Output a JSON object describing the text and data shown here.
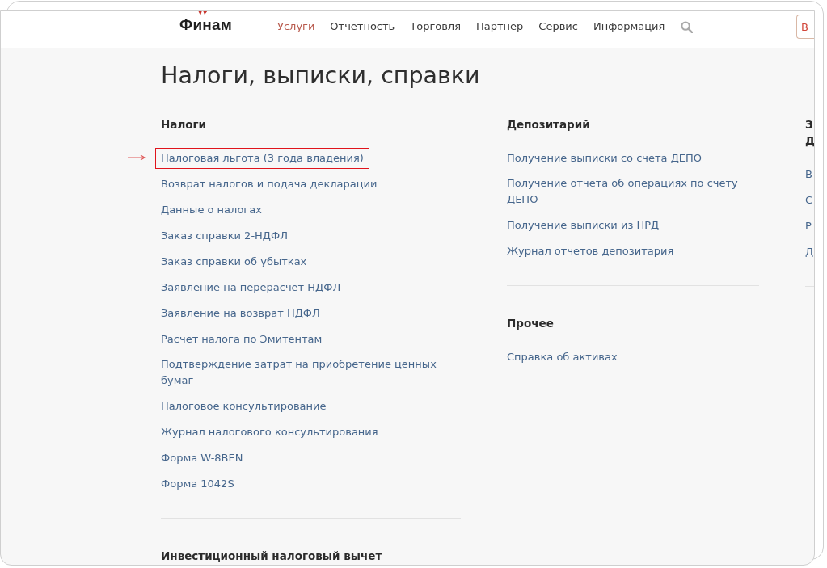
{
  "logo": {
    "text": "Финам"
  },
  "nav": [
    {
      "label": "Услуги",
      "selected": true
    },
    {
      "label": "Отчетность",
      "selected": false
    },
    {
      "label": "Торговля",
      "selected": false
    },
    {
      "label": "Партнер",
      "selected": false
    },
    {
      "label": "Сервис",
      "selected": false
    },
    {
      "label": "Информация",
      "selected": false
    }
  ],
  "header_button": {
    "label": "В"
  },
  "title": "Налоги, выписки, справки",
  "columns": [
    {
      "sections": [
        {
          "heading": "Налоги",
          "divider": true,
          "links": [
            {
              "label": "Налоговая льгота (3 года владения)",
              "highlighted": true
            },
            {
              "label": "Возврат налогов и подача декларации",
              "highlighted": false
            },
            {
              "label": "Данные о налогах",
              "highlighted": false
            },
            {
              "label": "Заказ справки 2-НДФЛ",
              "highlighted": false
            },
            {
              "label": "Заказ справки об убытках",
              "highlighted": false
            },
            {
              "label": "Заявление на перерасчет НДФЛ",
              "highlighted": false
            },
            {
              "label": "Заявление на возврат НДФЛ",
              "highlighted": false
            },
            {
              "label": "Расчет налога по Эмитентам",
              "highlighted": false
            },
            {
              "label": "Подтверждение затрат на приобретение ценных бумаг",
              "highlighted": false
            },
            {
              "label": "Налоговое консультирование",
              "highlighted": false
            },
            {
              "label": "Журнал налогового консультирования",
              "highlighted": false
            },
            {
              "label": "Форма W-8BEN",
              "highlighted": false
            },
            {
              "label": "Форма 1042S",
              "highlighted": false
            }
          ]
        },
        {
          "heading": "Инвестиционный налоговый вычет",
          "divider": false
        }
      ]
    },
    {
      "sections": [
        {
          "heading": "Депозитарий",
          "divider": true,
          "links": [
            {
              "label": "Получение выписки со счета ДЕПО",
              "highlighted": false
            },
            {
              "label": "Получение отчета об операциях по счету ДЕПО",
              "highlighted": false
            },
            {
              "label": "Получение выписки из НРД",
              "highlighted": false
            },
            {
              "label": "Журнал отчетов депозитария",
              "highlighted": false
            }
          ]
        },
        {
          "heading": "Прочее",
          "divider": false,
          "links": [
            {
              "label": "Справка об активах",
              "highlighted": false
            }
          ]
        }
      ]
    },
    {
      "sections": [
        {
          "heading": "З Д",
          "divider": true,
          "links": [
            {
              "label": "В",
              "highlighted": false
            },
            {
              "label": "С",
              "highlighted": false
            },
            {
              "label": "Р",
              "highlighted": false
            },
            {
              "label": "Д",
              "highlighted": false
            }
          ]
        }
      ]
    }
  ]
}
